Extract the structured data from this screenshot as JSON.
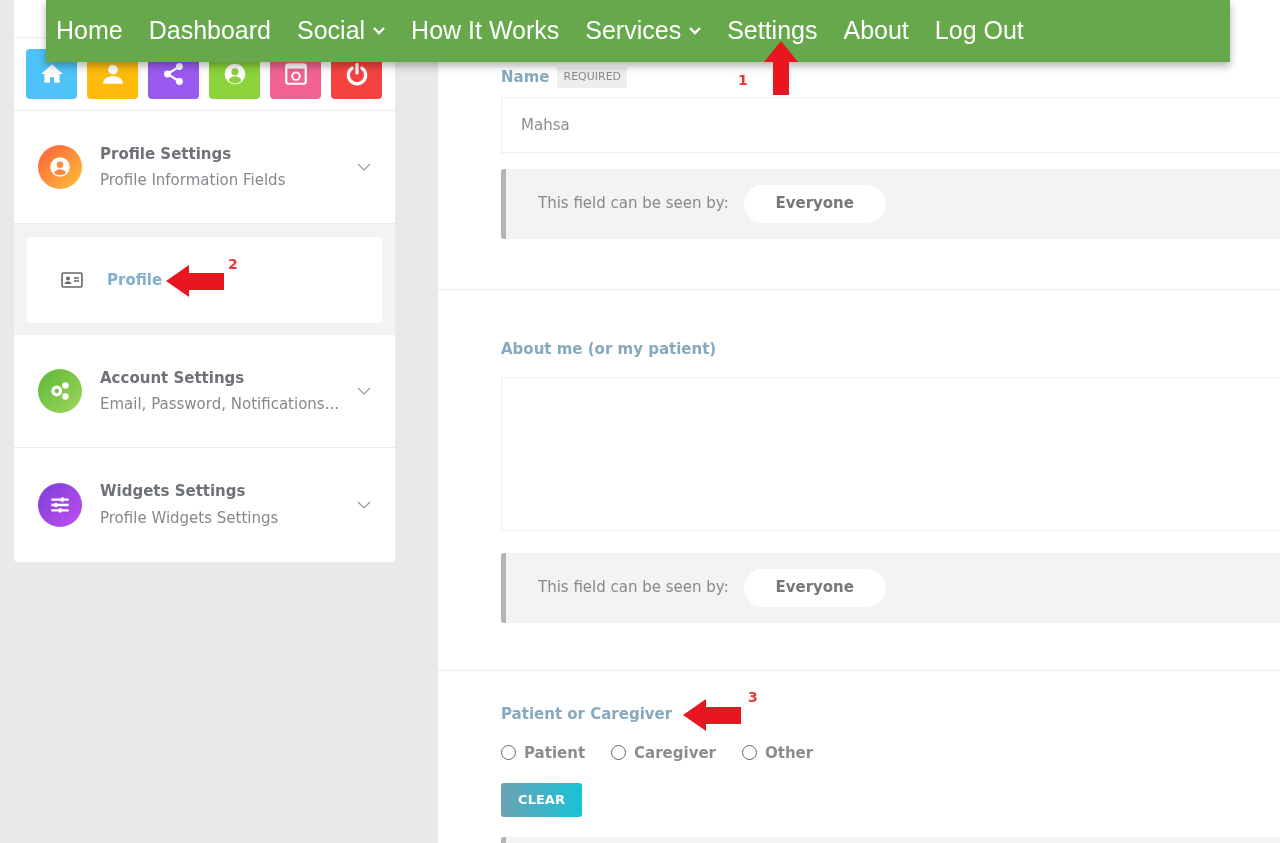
{
  "menu": [
    {
      "label": "Home",
      "dropdown": false
    },
    {
      "label": "Dashboard",
      "dropdown": false
    },
    {
      "label": "Social",
      "dropdown": true
    },
    {
      "label": "How It Works",
      "dropdown": false
    },
    {
      "label": "Services",
      "dropdown": true
    },
    {
      "label": "Settings",
      "dropdown": false
    },
    {
      "label": "About",
      "dropdown": false
    },
    {
      "label": "Log Out",
      "dropdown": false
    }
  ],
  "shortcuts": [
    {
      "kind": "home",
      "color": "#4dc3fa"
    },
    {
      "kind": "user",
      "color": "#fdbb0e"
    },
    {
      "kind": "share",
      "color": "#9b59f0"
    },
    {
      "kind": "avatar",
      "color": "#8cd23a"
    },
    {
      "kind": "window",
      "color": "#f06292"
    },
    {
      "kind": "power",
      "color": "#f4433f"
    }
  ],
  "sections": [
    {
      "kind": "profile",
      "title": "Profile Settings",
      "subtitle": "Profile Information Fields",
      "expanded": true,
      "children": [
        {
          "label": "Profile",
          "selected": true
        }
      ]
    },
    {
      "kind": "account",
      "title": "Account Settings",
      "subtitle": "Email, Password, Notifications...",
      "expanded": false
    },
    {
      "kind": "widgets",
      "title": "Widgets Settings",
      "subtitle": "Profile Widgets Settings",
      "expanded": false
    }
  ],
  "fields": [
    {
      "kind": "text",
      "label": "Name",
      "required_badge": "REQUIRED",
      "value": "Mahsa",
      "visibility_label": "This field can be seen by:",
      "visibility": "Everyone"
    },
    {
      "kind": "textarea",
      "label": "About me (or my patient)",
      "visibility_label": "This field can be seen by:",
      "visibility": "Everyone"
    },
    {
      "kind": "radio",
      "label": "Patient or Caregiver",
      "options": [
        {
          "label": "Patient",
          "checked": false
        },
        {
          "label": "Caregiver",
          "checked": false
        },
        {
          "label": "Other",
          "checked": false
        }
      ],
      "clear_button": "CLEAR"
    }
  ],
  "annotations": [
    {
      "label": "1",
      "kind": "up"
    },
    {
      "label": "2",
      "kind": "left"
    },
    {
      "label": "3",
      "kind": "left"
    }
  ]
}
